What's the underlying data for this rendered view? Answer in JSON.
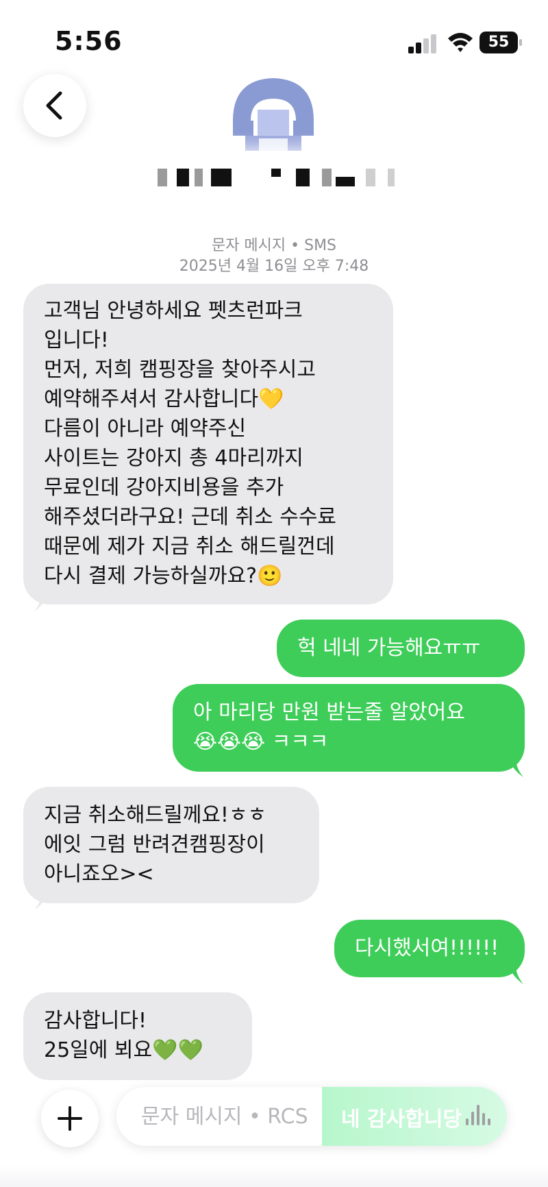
{
  "status_bar": {
    "time": "5:56",
    "battery": "55"
  },
  "header": {
    "back_icon": "chevron-left-icon",
    "avatar_icon": "person-avatar"
  },
  "thread_meta": {
    "service": "문자 메시지 • SMS",
    "date": "2025년 4월 16일 오후 7:48"
  },
  "messages": [
    {
      "direction": "incoming",
      "lines": [
        "고객님 안녕하세요 펫츠런파크",
        "입니다!",
        "먼저, 저희 캠핑장을 찾아주시고",
        "예약해주셔서 감사합니다💛",
        "다름이 아니라 예약주신",
        "사이트는 강아지 총 4마리까지",
        "무료인데 강아지비용을 추가",
        "해주셨더라구요! 근데 취소 수수료",
        "때문에 제가 지금 취소 해드릴껀데",
        "다시 결제 가능하실까요?🙂"
      ]
    },
    {
      "direction": "outgoing",
      "lines": [
        "헉 네네 가능해요ㅠㅠ"
      ]
    },
    {
      "direction": "outgoing",
      "lines": [
        "아 마리당 만원 받는줄 알았어요",
        "😭😭😭 ㅋㅋㅋ"
      ]
    },
    {
      "direction": "incoming",
      "lines": [
        "지금 취소해드릴께요!ㅎㅎ",
        "에잇 그럼 반려견캠핑장이",
        "아니죠오><"
      ]
    },
    {
      "direction": "outgoing",
      "lines": [
        "다시했서여!!!!!!"
      ]
    },
    {
      "direction": "incoming",
      "lines": [
        "감사합니다!",
        "25일에 뵈요💚💚"
      ]
    }
  ],
  "composer": {
    "placeholder": "문자 메시지 • RCS",
    "suggestion": "네 감사합니당",
    "add_icon": "plus-icon",
    "voice_icon": "waveform-icon"
  },
  "colors": {
    "incoming_bubble": "#e9e9eb",
    "outgoing_bubble": "#3dcd58",
    "meta_text": "#8e8e93"
  }
}
